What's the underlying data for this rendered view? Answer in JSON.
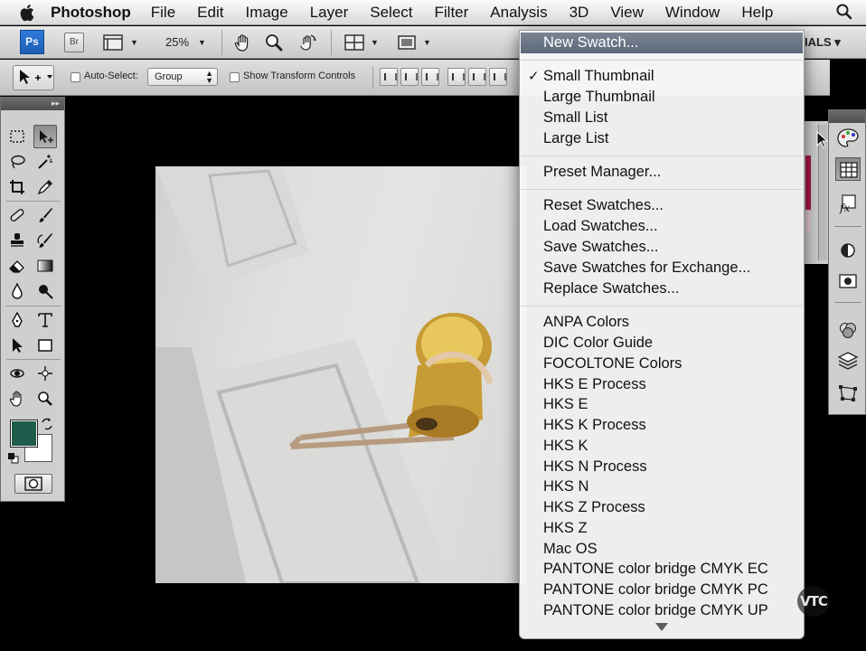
{
  "menubar": {
    "app": "Photoshop",
    "items": [
      "File",
      "Edit",
      "Image",
      "Layer",
      "Select",
      "Filter",
      "Analysis",
      "3D",
      "View",
      "Window",
      "Help"
    ]
  },
  "appbar": {
    "ps_label": "Ps",
    "br_label": "Br",
    "zoom": "25%",
    "workspace": "IALS ▾"
  },
  "options": {
    "auto_select_label": "Auto-Select:",
    "auto_select_value": "Group",
    "transform_label": "Show Transform Controls"
  },
  "colors": {
    "foreground": "#1f5c4b",
    "background": "#ffffff",
    "menu_highlight": "#66717f"
  },
  "flyout": {
    "new_swatch": "New Swatch...",
    "view_options": [
      {
        "label": "Small Thumbnail",
        "checked": true
      },
      {
        "label": "Large Thumbnail",
        "checked": false
      },
      {
        "label": "Small List",
        "checked": false
      },
      {
        "label": "Large List",
        "checked": false
      }
    ],
    "preset_manager": "Preset Manager...",
    "file_actions": [
      "Reset Swatches...",
      "Load Swatches...",
      "Save Swatches...",
      "Save Swatches for Exchange...",
      "Replace Swatches..."
    ],
    "libraries": [
      "ANPA Colors",
      "DIC Color Guide",
      "FOCOLTONE Colors",
      "HKS E Process",
      "HKS E",
      "HKS K Process",
      "HKS K",
      "HKS N Process",
      "HKS N",
      "HKS Z Process",
      "HKS Z",
      "Mac OS",
      "PANTONE color bridge CMYK EC",
      "PANTONE color bridge CMYK PC",
      "PANTONE color bridge CMYK UP"
    ]
  },
  "watermark": "VTC"
}
